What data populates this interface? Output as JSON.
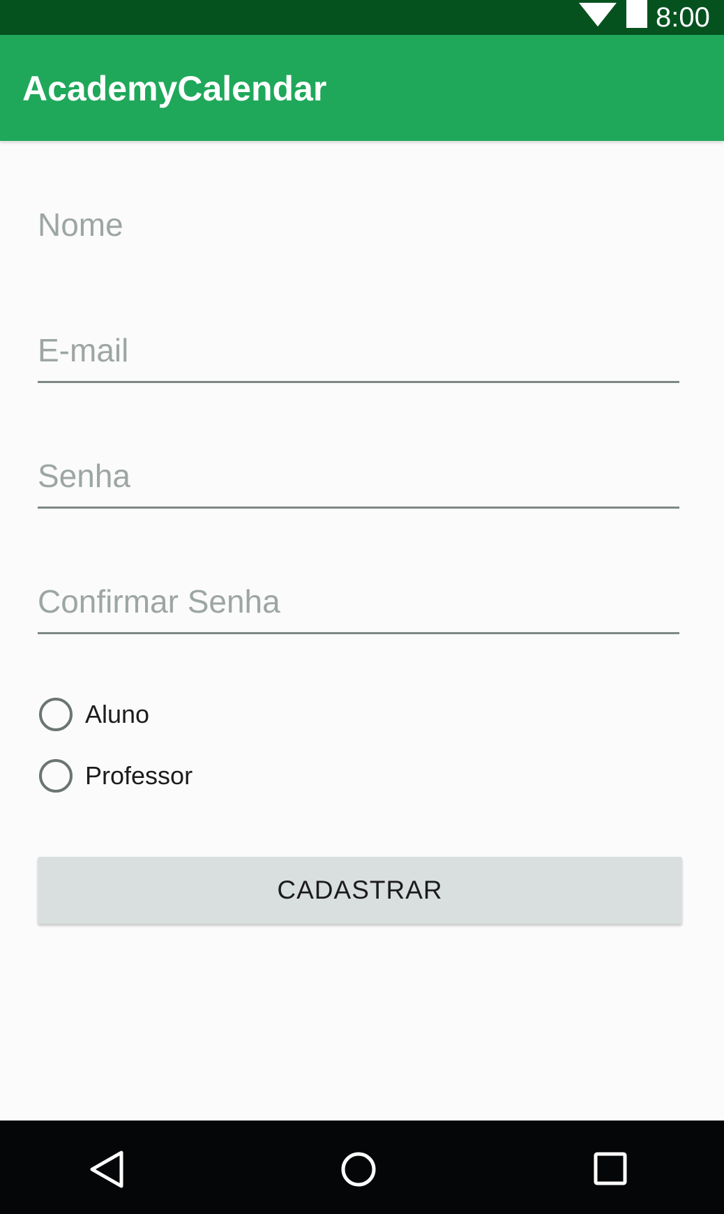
{
  "status_bar": {
    "time": "8:00",
    "wifi_icon": "wifi-icon",
    "battery_icon": "battery-icon"
  },
  "app_bar": {
    "title": "AcademyCalendar",
    "color": "#1fa85a",
    "status_color": "#05521f"
  },
  "form": {
    "name_placeholder": "Nome",
    "email_placeholder": "E-mail",
    "password_placeholder": "Senha",
    "confirm_password_placeholder": "Confirmar Senha",
    "role_options": [
      "Aluno",
      "Professor"
    ],
    "submit_label": "CADASTRAR"
  },
  "nav_bar": {
    "back_icon": "back-triangle-icon",
    "home_icon": "home-circle-icon",
    "recents_icon": "recents-square-icon"
  }
}
